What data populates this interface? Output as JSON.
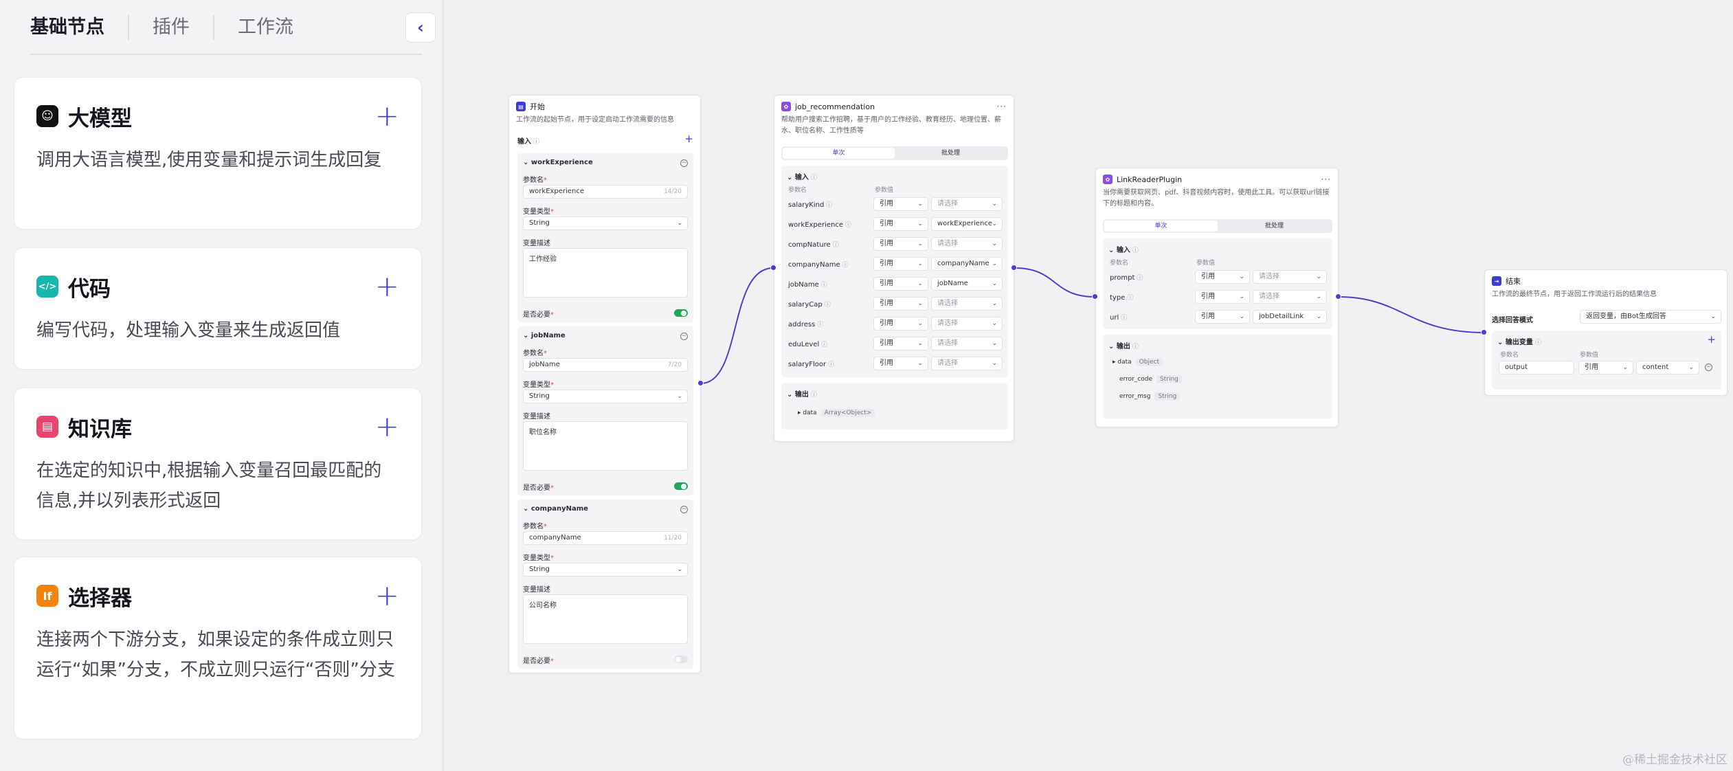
{
  "sidebar": {
    "tabs": [
      "基础节点",
      "插件",
      "工作流"
    ],
    "collapse_icon": "chevron-left-icon",
    "cards": [
      {
        "title": "大模型",
        "desc": "调用大语言模型,使用变量和提示词生成回复",
        "icon": "llm-icon",
        "color": "#111111",
        "glyph": "☺"
      },
      {
        "title": "代码",
        "desc": "编写代码，处理输入变量来生成返回值",
        "icon": "code-icon",
        "color": "#19b6ad",
        "glyph": "</>"
      },
      {
        "title": "知识库",
        "desc": "在选定的知识中,根据输入变量召回最匹配的信息,并以列表形式返回",
        "icon": "knowledge-icon",
        "color": "#e8456d",
        "glyph": "▤"
      },
      {
        "title": "选择器",
        "desc": "连接两个下游分支，如果设定的条件成立则只运行“如果”分支，不成立则只运行“否则”分支",
        "icon": "if-icon",
        "color": "#f5820f",
        "glyph": "If"
      }
    ]
  },
  "start_node": {
    "title": "开始",
    "desc": "工作流的起始节点，用于设定启动工作流需要的信息",
    "input_label": "输入",
    "param_label": "参数名",
    "type_label": "变量类型",
    "desc_label": "变量描述",
    "required_label": "是否必要",
    "params": [
      {
        "name": "workExperience",
        "count": "14/20",
        "type": "String",
        "desc": "工作经验",
        "required": true
      },
      {
        "name": "jobName",
        "count": "7/20",
        "type": "String",
        "desc": "职位名称",
        "required": true
      },
      {
        "name": "companyName",
        "count": "11/20",
        "type": "String",
        "desc": "公司名称",
        "required": false
      }
    ]
  },
  "job_node": {
    "title": "job_recommendation",
    "desc": "帮助用户搜索工作招聘，基于用户的工作经验、教育经历、地理位置、薪水、职位名称、工作性质等",
    "tabs": [
      "单次",
      "批处理"
    ],
    "input_label": "输入",
    "col_name": "参数名",
    "col_value": "参数值",
    "ref_label": "引用",
    "placeholder": "请选择",
    "rows": [
      {
        "name": "salaryKind",
        "value": ""
      },
      {
        "name": "workExperience",
        "value": "workExperience"
      },
      {
        "name": "compNature",
        "value": ""
      },
      {
        "name": "companyName",
        "value": "companyName"
      },
      {
        "name": "jobName",
        "value": "jobName"
      },
      {
        "name": "salaryCap",
        "value": ""
      },
      {
        "name": "address",
        "value": ""
      },
      {
        "name": "eduLevel",
        "value": ""
      },
      {
        "name": "salaryFloor",
        "value": ""
      }
    ],
    "output_label": "输出",
    "outputs": [
      {
        "name": "data",
        "type": "Array<Object>"
      }
    ]
  },
  "link_node": {
    "title": "LinkReaderPlugin",
    "desc": "当你需要获取网页、pdf、抖音视频内容时，使用此工具。可以获取url链接下的标题和内容。",
    "tabs": [
      "单次",
      "批处理"
    ],
    "input_label": "输入",
    "col_name": "参数名",
    "col_value": "参数值",
    "ref_label": "引用",
    "placeholder": "请选择",
    "rows": [
      {
        "name": "prompt",
        "value": ""
      },
      {
        "name": "type",
        "value": ""
      },
      {
        "name": "url",
        "value": "jobDetailLink"
      }
    ],
    "output_label": "输出",
    "outputs": [
      {
        "name": "data",
        "type": "Object"
      },
      {
        "name": "error_code",
        "type": "String"
      },
      {
        "name": "error_msg",
        "type": "String"
      }
    ]
  },
  "end_node": {
    "title": "结束",
    "desc": "工作流的最终节点，用于返回工作流运行后的结果信息",
    "mode_label": "选择回答模式",
    "mode_value": "返回变量，由Bot生成回答",
    "output_label": "输出变量",
    "col_name": "参数名",
    "col_value": "参数值",
    "var_name": "output",
    "ref_label": "引用",
    "var_value": "content"
  },
  "watermark": "@稀土掘金技术社区",
  "colors": {
    "accent": "#3f3bd6",
    "port": "#4a3fd0",
    "toggle_on": "#21a65a"
  }
}
